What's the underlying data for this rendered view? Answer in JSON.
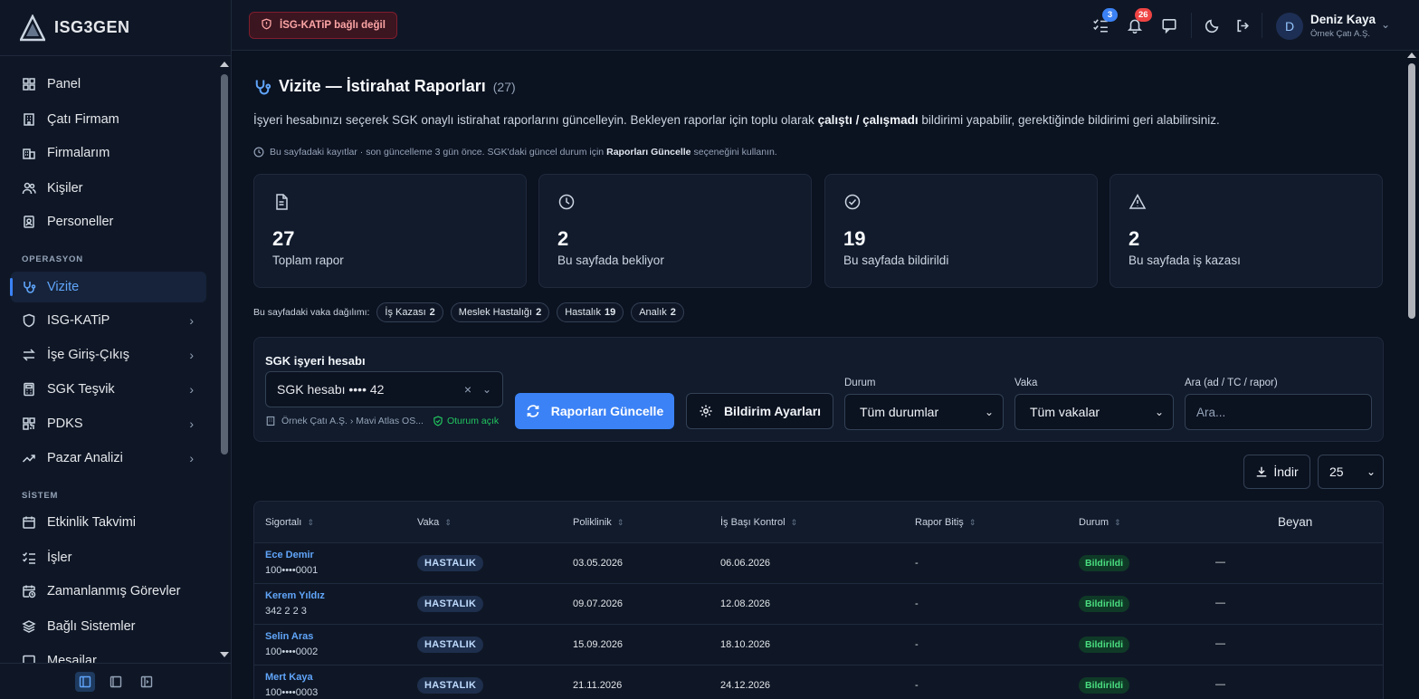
{
  "app": {
    "brand": "ISG3GEN"
  },
  "sidebar": {
    "items": [
      {
        "label": "Panel",
        "icon": "grid-icon"
      },
      {
        "label": "Çatı Firmam",
        "icon": "building-icon"
      },
      {
        "label": "Firmalarım",
        "icon": "buildings-icon"
      },
      {
        "label": "Kişiler",
        "icon": "users-icon"
      },
      {
        "label": "Personeller",
        "icon": "id-badge-icon"
      }
    ],
    "section_operasyon": "OPERASYON",
    "operasyon_items": [
      {
        "label": "Vizite",
        "icon": "stethoscope-icon",
        "active": true
      },
      {
        "label": "ISG-KATiP",
        "icon": "shield-icon",
        "chevron": true
      },
      {
        "label": "İşe Giriş-Çıkış",
        "icon": "arrows-icon",
        "chevron": true
      },
      {
        "label": "SGK Teşvik",
        "icon": "calculator-icon",
        "chevron": true
      },
      {
        "label": "PDKS",
        "icon": "qr-icon",
        "chevron": true
      },
      {
        "label": "Pazar Analizi",
        "icon": "trend-icon",
        "chevron": true
      }
    ],
    "section_sistem": "SİSTEM",
    "sistem_items": [
      {
        "label": "Etkinlik Takvimi",
        "icon": "calendar-icon"
      },
      {
        "label": "İşler",
        "icon": "list-check-icon"
      },
      {
        "label": "Zamanlanmış Görevler",
        "icon": "calendar-clock-icon"
      },
      {
        "label": "Bağlı Sistemler",
        "icon": "layers-icon"
      },
      {
        "label": "Mesajlar",
        "icon": "message-icon"
      }
    ]
  },
  "topbar": {
    "katip_status": "İSG-KATiP bağlı değil",
    "tasks_badge": "3",
    "notifications_badge": "26",
    "user": {
      "initial": "D",
      "name": "Deniz Kaya",
      "org": "Örnek Çatı A.Ş."
    }
  },
  "page": {
    "title": "Vizite — İstirahat Raporları",
    "count": "(27)",
    "desc_pre": "İşyeri hesabınızı seçerek SGK onaylı istirahat raporlarını güncelleyin. Bekleyen raporlar için toplu olarak",
    "desc_bold": "çalıştı / çalışmadı",
    "desc_post": "bildirimi yapabilir, gerektiğinde bildirimi geri alabilirsiniz.",
    "note_pre": "Bu sayfadaki kayıtlar · son güncelleme 3 gün önce. SGK'daki güncel durum için",
    "note_bold": "Raporları Güncelle",
    "note_post": "seçeneğini kullanın."
  },
  "stats": [
    {
      "value": "27",
      "label": "Toplam rapor",
      "icon": "document-icon"
    },
    {
      "value": "2",
      "label": "Bu sayfada bekliyor",
      "icon": "clock-icon"
    },
    {
      "value": "19",
      "label": "Bu sayfada bildirildi",
      "icon": "check-circle-icon"
    },
    {
      "value": "2",
      "label": "Bu sayfada iş kazası",
      "icon": "warning-icon"
    }
  ],
  "distribution": {
    "label": "Bu sayfadaki vaka dağılımı:",
    "chips": [
      {
        "label": "İş Kazası",
        "count": "2"
      },
      {
        "label": "Meslek Hastalığı",
        "count": "2"
      },
      {
        "label": "Hastalık",
        "count": "19"
      },
      {
        "label": "Analık",
        "count": "2"
      }
    ]
  },
  "filters": {
    "title": "SGK işyeri hesabı",
    "account_value": "SGK hesabı •••• 42",
    "account_info": "Örnek Çatı A.Ş. › Mavi Atlas OS...",
    "session": "Oturum açık",
    "update_button": "Raporları Güncelle",
    "settings_button": "Bildirim Ayarları",
    "status_label": "Durum",
    "status_value": "Tüm durumlar",
    "case_label": "Vaka",
    "case_value": "Tüm vakalar",
    "search_label": "Ara (ad / TC / rapor)",
    "search_placeholder": "Ara..."
  },
  "toolbar": {
    "download": "İndir",
    "page_size": "25"
  },
  "table": {
    "columns": [
      "Sigortalı",
      "Vaka",
      "Poliklinik",
      "İş Başı Kontrol",
      "Rapor Bitiş",
      "Durum",
      "Beyan"
    ],
    "rows": [
      {
        "name": "Ece Demir",
        "tc": "100••••0001",
        "case": "HASTALIK",
        "poliklinik": "03.05.2026",
        "kontrol": "06.06.2026",
        "bitis": "-",
        "status": "Bildirildi",
        "beyan": "—"
      },
      {
        "name": "Kerem Yıldız",
        "tc": "342 2 2 3",
        "case": "HASTALIK",
        "poliklinik": "09.07.2026",
        "kontrol": "12.08.2026",
        "bitis": "-",
        "status": "Bildirildi",
        "beyan": "—"
      },
      {
        "name": "Selin Aras",
        "tc": "100••••0002",
        "case": "HASTALIK",
        "poliklinik": "15.09.2026",
        "kontrol": "18.10.2026",
        "bitis": "-",
        "status": "Bildirildi",
        "beyan": "—"
      },
      {
        "name": "Mert Kaya",
        "tc": "100••••0003",
        "case": "HASTALIK",
        "poliklinik": "21.11.2026",
        "kontrol": "24.12.2026",
        "bitis": "-",
        "status": "Bildirildi",
        "beyan": "—"
      }
    ]
  },
  "colors": {
    "accent": "#3b82f6",
    "danger": "#fca5a5",
    "success": "#4ade80",
    "bg": "#0b1220"
  }
}
